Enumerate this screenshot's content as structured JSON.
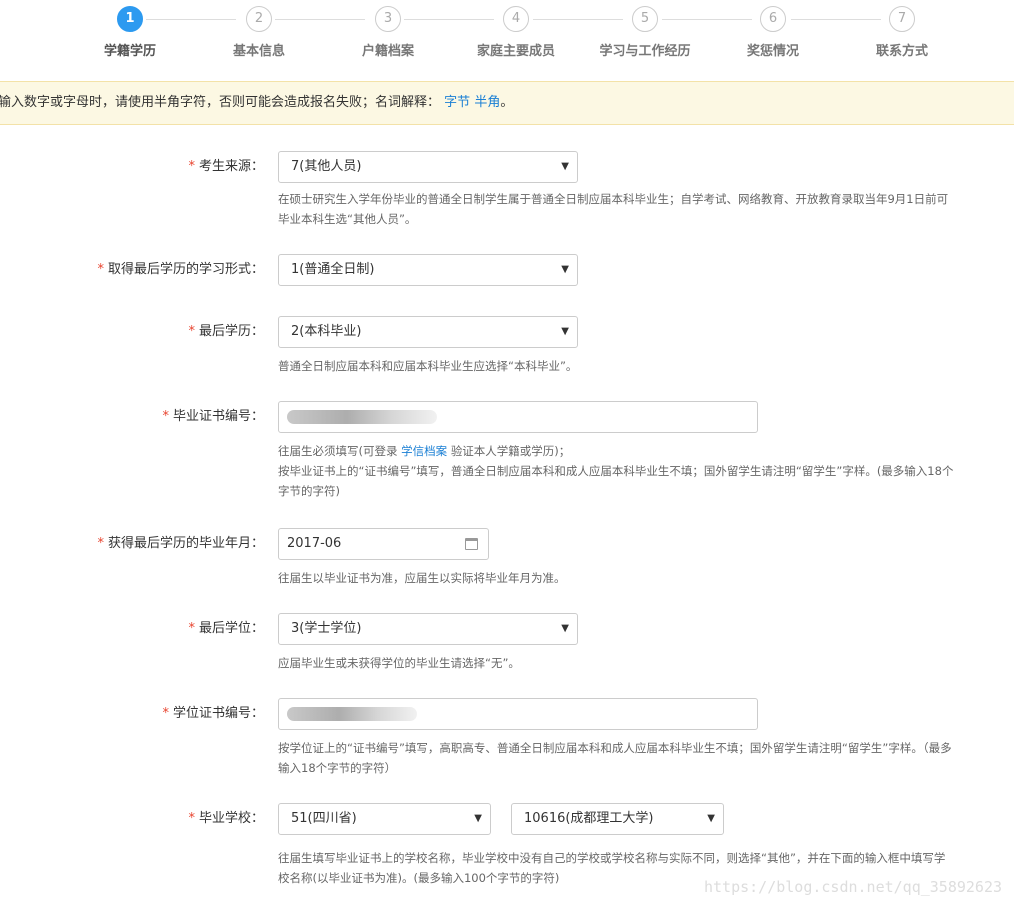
{
  "steps": [
    {
      "num": "1",
      "label": "学籍学历"
    },
    {
      "num": "2",
      "label": "基本信息"
    },
    {
      "num": "3",
      "label": "户籍档案"
    },
    {
      "num": "4",
      "label": "家庭主要成员"
    },
    {
      "num": "5",
      "label": "学习与工作经历"
    },
    {
      "num": "6",
      "label": "奖惩情况"
    },
    {
      "num": "7",
      "label": "联系方式"
    }
  ],
  "notice": {
    "text": "输入数字或字母时，请使用半角字符，否则可能会造成报名失败；名词解释：",
    "link1": "字节",
    "link2": "半角",
    "end": "。"
  },
  "form": {
    "source": {
      "label": "考生来源：",
      "value": "7(其他人员)",
      "help1": "在硕士研究生入学年份毕业的普通全日制学生属于普通全日制应届本科毕业生；自学考试、网络教育、开放教育录取当年9月1日前可",
      "help2": "毕业本科生选“其他人员”。"
    },
    "study_form": {
      "label": "取得最后学历的学习形式：",
      "value": "1(普通全日制)"
    },
    "last_degree_edu": {
      "label": "最后学历：",
      "value": "2(本科毕业)",
      "help1": "普通全日制应届本科和应届本科毕业生应选择“本科毕业”。"
    },
    "diploma_no": {
      "label": "毕业证书编号：",
      "value": "",
      "help1a": "往届生必须填写(可登录",
      "help1link": "学信档案",
      "help1b": "验证本人学籍或学历)；",
      "help2": "按毕业证书上的“证书编号”填写，普通全日制应届本科和成人应届本科毕业生不填；国外留学生请注明“留学生”字样。(最多输入18个",
      "help3": "字节的字符)"
    },
    "grad_date": {
      "label": "获得最后学历的毕业年月：",
      "value": "2017-06",
      "help1": "往届生以毕业证书为准，应届生以实际将毕业年月为准。"
    },
    "last_degree": {
      "label": "最后学位：",
      "value": "3(学士学位)",
      "help1": "应届毕业生或未获得学位的毕业生请选择“无”。"
    },
    "degree_cert_no": {
      "label": "学位证书编号：",
      "value": "",
      "help1": "按学位证上的“证书编号”填写，高职高专、普通全日制应届本科和成人应届本科毕业生不填；国外留学生请注明“留学生”字样。（最多",
      "help2": "输入18个字节的字符）"
    },
    "school": {
      "label": "毕业学校：",
      "province": "51(四川省)",
      "school": "10616(成都理工大学)",
      "help1": "往届生填写毕业证书上的学校名称，毕业学校中没有自己的学校或学校名称与实际不同，则选择“其他”，并在下面的输入框中填写学",
      "help2": "校名称(以毕业证书为准)。(最多输入100个字节的字符)"
    }
  },
  "watermark": "https://blog.csdn.net/qq_35892623",
  "colors": {
    "accent": "#2d9af0",
    "required": "#e8432e",
    "notice_bg": "#fcf8e3",
    "link": "#1a7fd4"
  }
}
